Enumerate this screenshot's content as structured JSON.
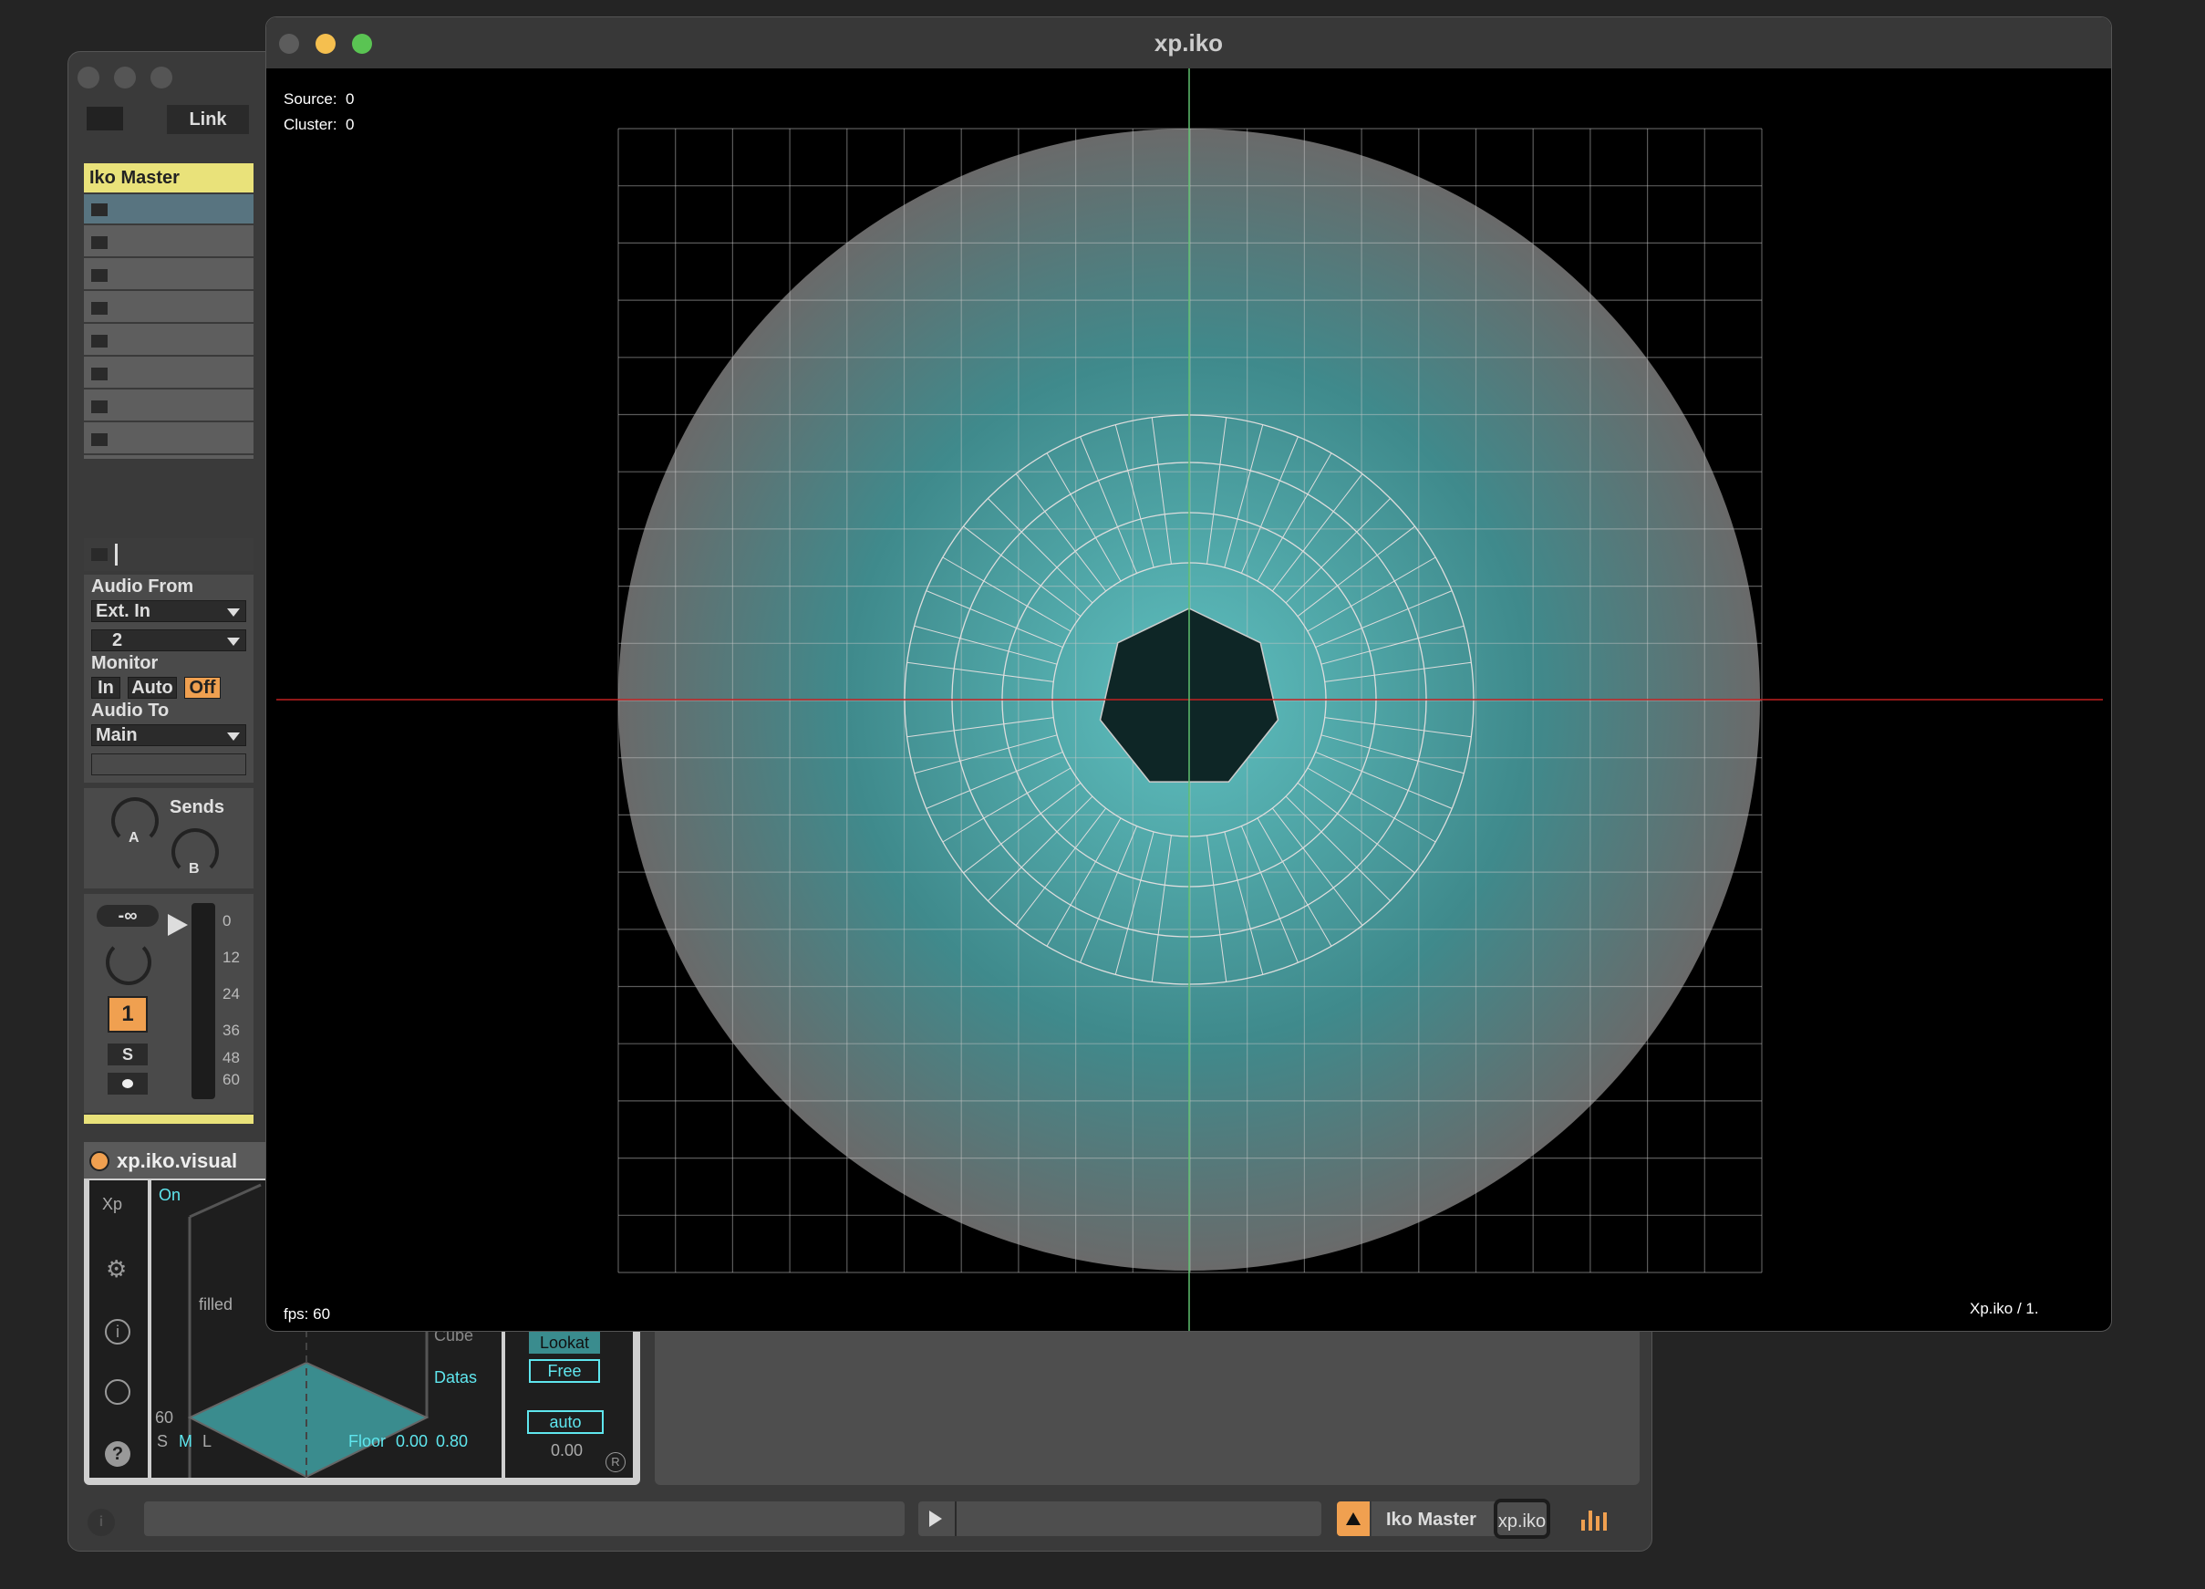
{
  "back_window": {
    "link_label": "Link",
    "track": {
      "name": "Iko Master",
      "color": "#e9e27a",
      "clip_count": 8,
      "audio_from_label": "Audio From",
      "audio_from_value": "Ext. In",
      "input_channel": "2",
      "monitor_label": "Monitor",
      "monitor_options": [
        "In",
        "Auto",
        "Off"
      ],
      "monitor_selected": "Off",
      "audio_to_label": "Audio To",
      "audio_to_value": "Main",
      "sends_label": "Sends",
      "send_a": "A",
      "send_b": "B",
      "volume_readout": "-∞",
      "meter_ticks": [
        "0",
        "12",
        "24",
        "36",
        "48",
        "60"
      ],
      "track_number": "1",
      "solo_label": "S"
    },
    "device": {
      "name": "xp.iko.visual",
      "tab_label": "Xp",
      "on_label": "On",
      "filled_label": "filled",
      "cube_label": "Cube",
      "datas_label": "Datas",
      "fps_value": "60",
      "size_options": [
        "S",
        "M",
        "L"
      ],
      "size_selected": "M",
      "floor_label": "Floor",
      "floor_values": [
        "0.00",
        "0.80"
      ],
      "lookat_label": "Lookat",
      "free_label": "Free",
      "auto_label": "auto",
      "auto_value": "0.00",
      "r_label": "R"
    },
    "statusbar": {
      "track_name": "Iko Master",
      "device_chip": "xp.iko"
    }
  },
  "viewer": {
    "title": "xp.iko",
    "source_label": "Source:",
    "source_value": "0",
    "cluster_label": "Cluster:",
    "cluster_value": "0",
    "fps_label": "fps:",
    "fps_value": "60",
    "footer_label": "Xp.iko / 1."
  },
  "colors": {
    "accent_orange": "#f0a050",
    "cyan": "#5fe6ee",
    "track_yellow": "#e9e27a",
    "sphere": "#4aa6a8"
  }
}
